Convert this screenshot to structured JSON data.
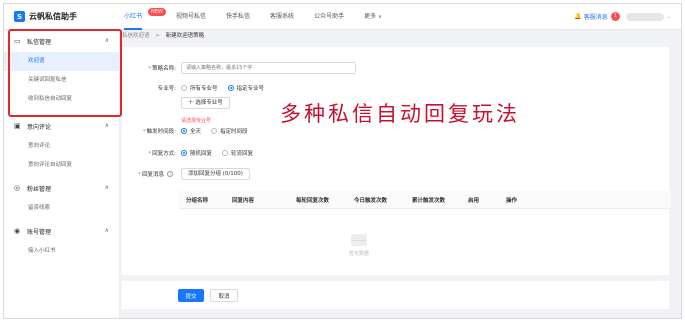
{
  "app": {
    "logo_letter": "S",
    "title": "云帆私信助手"
  },
  "nav": {
    "items": [
      {
        "label": "小红书",
        "badge": "NEW"
      },
      {
        "label": "视频号私信"
      },
      {
        "label": "快手私信"
      },
      {
        "label": "客服系统"
      },
      {
        "label": "公众号助手"
      },
      {
        "label": "更多"
      }
    ],
    "more_caret": "∨"
  },
  "header_right": {
    "bell": "🔔",
    "label": "客服消息",
    "count": "1",
    "caret": "⌄"
  },
  "sidebar": {
    "groups": [
      {
        "label": "私信管理",
        "icon": "▭",
        "caret": "∧",
        "items": [
          "欢迎语",
          "关键词回复私信",
          "收到私信自动回复"
        ]
      },
      {
        "label": "意向评论",
        "icon": "▣",
        "caret": "∧",
        "items": [
          "意向评论",
          "意向评论自动回复"
        ]
      },
      {
        "label": "粉丝管理",
        "icon": "◎",
        "caret": "∧",
        "items": [
          "留资线索"
        ]
      },
      {
        "label": "账号管理",
        "icon": "◉",
        "caret": "∧",
        "items": [
          "接入小红书"
        ]
      }
    ]
  },
  "breadcrumb": {
    "parent": "私信欢迎语",
    "sep": ">",
    "current": "新建欢迎语策略"
  },
  "form": {
    "name_label": "策略名称:",
    "name_placeholder": "请输入策略名称，最多15个字",
    "account_label": "专业号:",
    "account_opt_all": "所有专业号",
    "account_opt_specific": "指定专业号",
    "select_account_button": "＋ 选择专业号",
    "account_error": "请选择专业号",
    "trigger_label": "触发时间段:",
    "trigger_all": "全天",
    "trigger_specific": "指定时间段",
    "mode_label": "回复方式:",
    "mode_random": "随机回复",
    "mode_rotate": "轮流回复",
    "message_label": "回复消息",
    "info_glyph": "i",
    "add_group_button": "添加回复分组 (0/100)"
  },
  "overlay_text": "多种私信自动回复玩法",
  "table": {
    "columns": [
      "分组名称",
      "回复内容",
      "每轮回复次数",
      "今日触发次数",
      "累计触发次数",
      "启用",
      "操作"
    ],
    "empty_text": "暂无数据"
  },
  "footer": {
    "submit": "提交",
    "cancel": "取消"
  }
}
